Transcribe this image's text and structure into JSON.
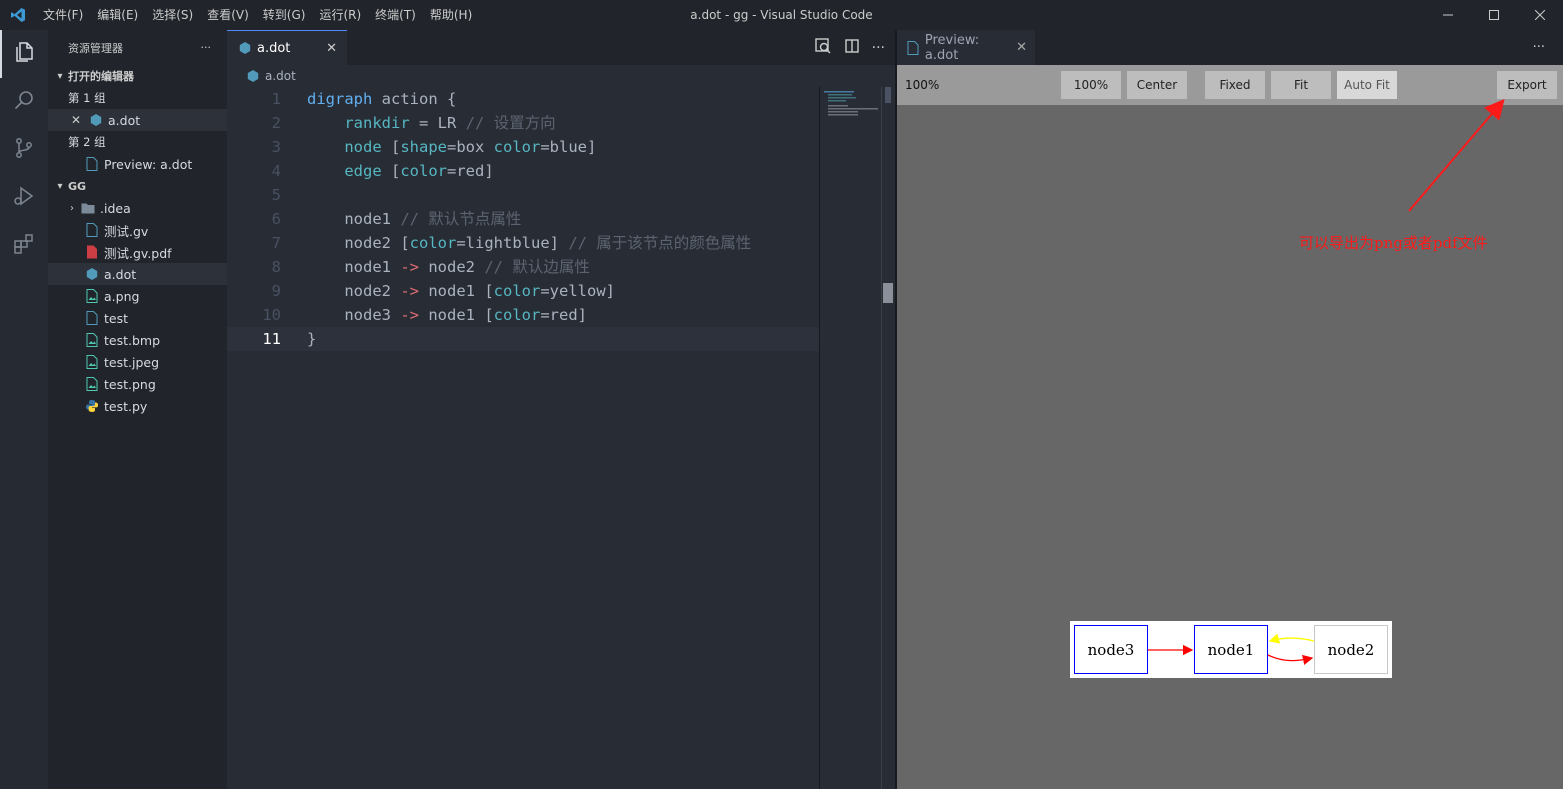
{
  "titlebar": {
    "menus": [
      "文件(F)",
      "编辑(E)",
      "选择(S)",
      "查看(V)",
      "转到(G)",
      "运行(R)",
      "终端(T)",
      "帮助(H)"
    ],
    "title": "a.dot - gg - Visual Studio Code"
  },
  "activity": [
    "files-icon",
    "search-icon",
    "source-control-icon",
    "run-debug-icon",
    "extensions-icon"
  ],
  "sidebar": {
    "title": "资源管理器",
    "more": "···",
    "open_editors": {
      "label": "打开的编辑器",
      "group1": "第 1 组",
      "group1_file": "a.dot",
      "group2": "第 2 组",
      "group2_file": "Preview: a.dot"
    },
    "folder": {
      "label": "GG",
      "items": [
        {
          "name": ".idea",
          "icon": "folder-icon"
        },
        {
          "name": "测试.gv",
          "icon": "file-icon"
        },
        {
          "name": "测试.gv.pdf",
          "icon": "pdf-icon"
        },
        {
          "name": "a.dot",
          "icon": "dot-icon"
        },
        {
          "name": "a.png",
          "icon": "image-icon"
        },
        {
          "name": "test",
          "icon": "file-icon"
        },
        {
          "name": "test.bmp",
          "icon": "image-icon"
        },
        {
          "name": "test.jpeg",
          "icon": "image-icon"
        },
        {
          "name": "test.png",
          "icon": "image-icon"
        },
        {
          "name": "test.py",
          "icon": "python-icon"
        }
      ]
    }
  },
  "editor": {
    "tab": "a.dot",
    "breadcrumb": "a.dot",
    "line_numbers": [
      "1",
      "2",
      "3",
      "4",
      "5",
      "6",
      "7",
      "8",
      "9",
      "10",
      "11"
    ],
    "current_line": 11
  },
  "preview": {
    "tab": "Preview: a.dot",
    "more": "···",
    "zoom": "100%",
    "buttons": {
      "b100": "100%",
      "center": "Center",
      "fixed": "Fixed",
      "fit": "Fit",
      "autofit": "Auto Fit",
      "export": "Export"
    },
    "nodes": {
      "n3": "node3",
      "n1": "node1",
      "n2": "node2"
    },
    "annotation": "可以导出为png或者pdf文件",
    "colors": {
      "node_border": "#0000ff",
      "node2_border": "#add8e6",
      "edge": "#ff0000",
      "edge_yellow": "#ffff00",
      "annotation": "#ff0000"
    }
  }
}
